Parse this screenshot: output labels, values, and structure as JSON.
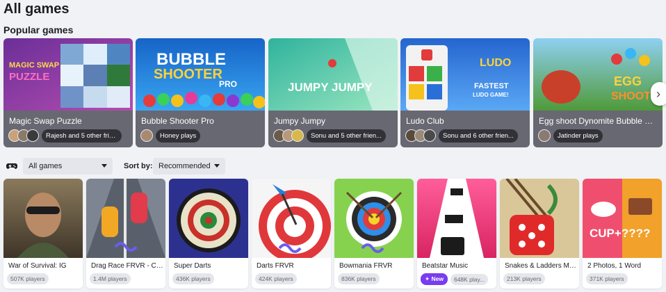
{
  "page": {
    "title": "All games"
  },
  "popular": {
    "title": "Popular games",
    "cards": [
      {
        "name": "Magic Swap Puzzle",
        "social": "Rajesh and 5 other frie...",
        "avatar_count": 3,
        "colors": [
          "#7a3fa8",
          "#c84fbf"
        ]
      },
      {
        "name": "Bubble Shooter Pro",
        "social": "Honey plays",
        "avatar_count": 1,
        "colors": [
          "#1b6fd0",
          "#36a4f0"
        ]
      },
      {
        "name": "Jumpy Jumpy",
        "social": "Sonu and 5 other frien...",
        "avatar_count": 3,
        "colors": [
          "#39b8a6",
          "#8fe0b8"
        ]
      },
      {
        "name": "Ludo Club",
        "social": "Sonu and 6 other frien...",
        "avatar_count": 3,
        "colors": [
          "#2a6fd8",
          "#5aa8f5"
        ]
      },
      {
        "name": "Egg shoot Dynomite Bubble Sh...",
        "social": "Jatinder plays",
        "avatar_count": 1,
        "colors": [
          "#3f8f3c",
          "#9bd35a"
        ]
      }
    ]
  },
  "filters": {
    "category_value": "All games",
    "sort_label": "Sort by:",
    "sort_value": "Recommended"
  },
  "games": [
    {
      "name": "War of Survival: IG",
      "players": "507K players",
      "is_new": false,
      "colors": [
        "#5a4b3a",
        "#9a8463"
      ]
    },
    {
      "name": "Drag Race FRVR - Car...",
      "players": "1.4M players",
      "is_new": false,
      "colors": [
        "#6f7480",
        "#b6bcc8"
      ]
    },
    {
      "name": "Super Darts",
      "players": "436K players",
      "is_new": false,
      "colors": [
        "#2b2f8a",
        "#4b54d8"
      ]
    },
    {
      "name": "Darts FRVR",
      "players": "424K players",
      "is_new": false,
      "colors": [
        "#f4f4f4",
        "#e23b3b"
      ]
    },
    {
      "name": "Bowmania FRVR",
      "players": "836K players",
      "is_new": false,
      "colors": [
        "#7ccf4a",
        "#b8e986"
      ]
    },
    {
      "name": "Beatstar Music",
      "players": "648K play...",
      "is_new": true,
      "new_label": "New",
      "colors": [
        "#e8306f",
        "#ff6aa1"
      ]
    },
    {
      "name": "Snakes & Ladders Mu...",
      "players": "213K players",
      "is_new": false,
      "colors": [
        "#d8c9a0",
        "#e23030"
      ]
    },
    {
      "name": "2 Photos, 1 Word",
      "players": "371K players",
      "is_new": false,
      "colors": [
        "#f04e6e",
        "#f2a12a"
      ]
    }
  ],
  "icons": {
    "next": "chevron-right-icon",
    "category": "game-controller-icon",
    "new": "sparkle-icon"
  }
}
